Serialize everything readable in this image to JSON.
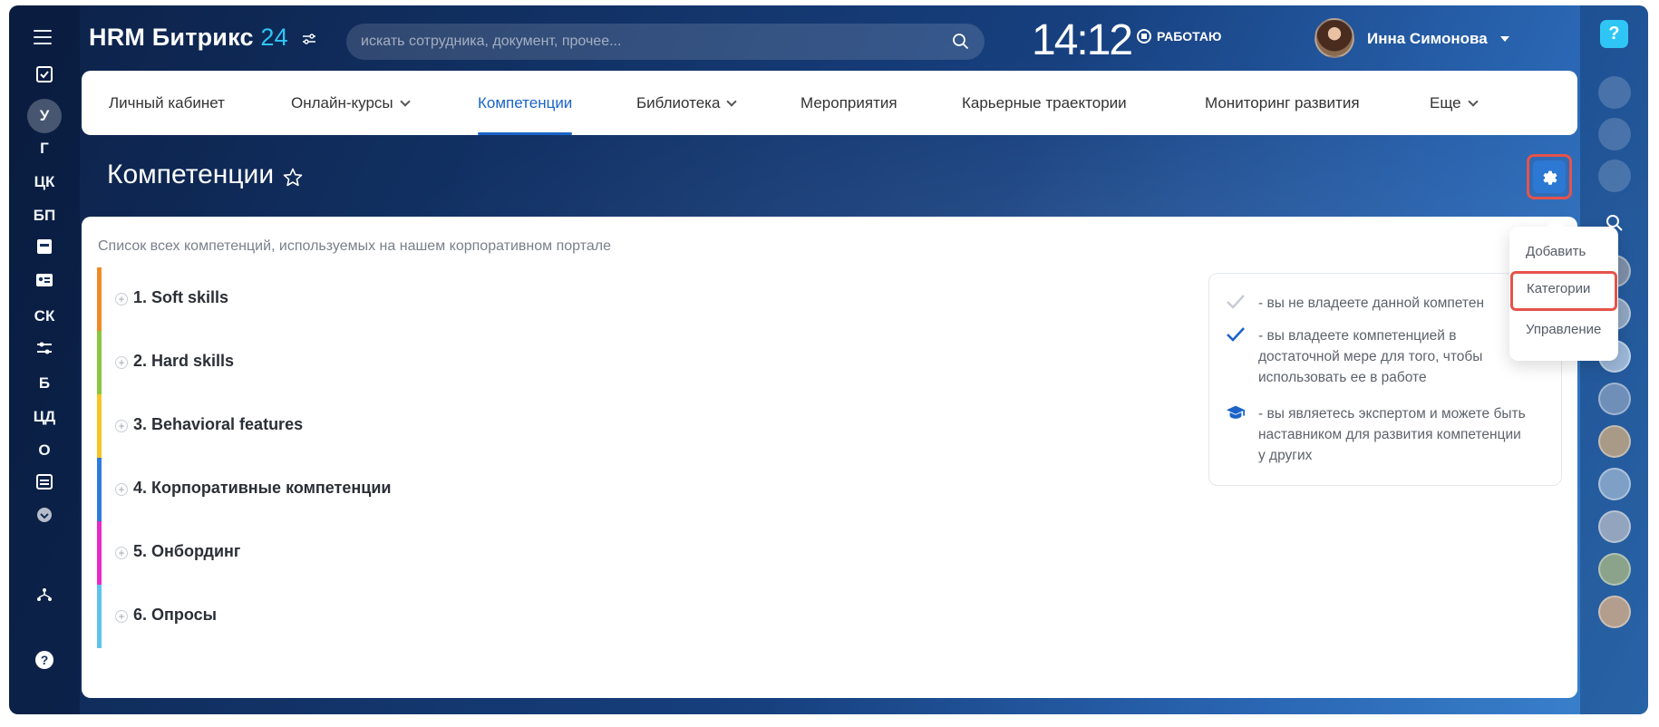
{
  "header": {
    "logo_main": "HRM Битрикс",
    "logo_num": "24",
    "search_placeholder": "искать сотрудника, документ, прочее...",
    "clock": "14:12",
    "work_status": "РАБОТАЮ",
    "user_name": "Инна Симонова"
  },
  "sidebar_left": {
    "letters": [
      "У",
      "Г",
      "ЦК",
      "БП",
      "СК",
      "Б",
      "ЦД",
      "О"
    ]
  },
  "nav": {
    "tabs": [
      {
        "label": "Личный кабинет"
      },
      {
        "label": "Онлайн-курсы"
      },
      {
        "label": "Компетенции"
      },
      {
        "label": "Библиотека"
      },
      {
        "label": "Мероприятия"
      },
      {
        "label": "Карьерные траектории"
      },
      {
        "label": "Мониторинг развития"
      },
      {
        "label": "Еще"
      }
    ],
    "active": "Компетенции"
  },
  "page": {
    "title": "Компетенции",
    "description": "Список всех компетенций, используемых на нашем корпоративном портале"
  },
  "categories": [
    {
      "label": "1. Soft skills",
      "color": "#f08a24"
    },
    {
      "label": "2. Hard skills",
      "color": "#8cc63f"
    },
    {
      "label": "3. Behavioral features",
      "color": "#f7c325"
    },
    {
      "label": "4. Корпоративные компетенции",
      "color": "#2e7be0"
    },
    {
      "label": "5. Онбординг",
      "color": "#e829c8"
    },
    {
      "label": "6. Опросы",
      "color": "#5ec3ec"
    }
  ],
  "legend": {
    "item1": "- вы не владеете данной компетен",
    "item2": "- вы владеете компетенцией в достаточной мере для того, чтобы использовать ее в работе",
    "item3": "- вы являетесь экспертом и можете быть наставником для развития компетенции у других"
  },
  "settings_menu": {
    "items": [
      "Добавить",
      "Категории",
      "Управление"
    ],
    "highlighted": "Категории"
  },
  "colors": {
    "accent": "#1a64c8",
    "highlight_border": "#e5534b",
    "help_badge": "#2fc6f6"
  }
}
